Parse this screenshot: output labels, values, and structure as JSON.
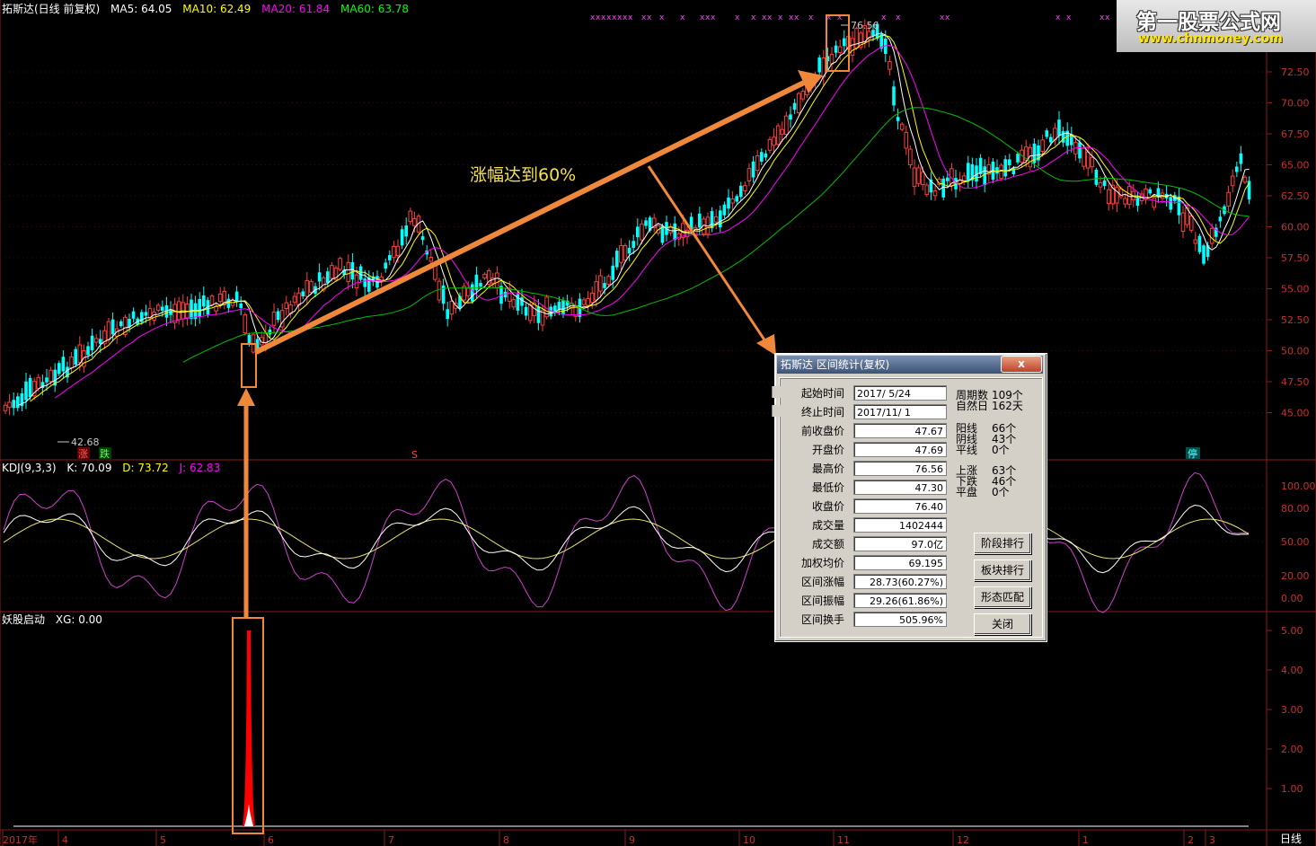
{
  "header": {
    "stock": "拓斯达(日线 前复权)",
    "ma5": "MA5: 64.05",
    "ma10": "MA10: 62.49",
    "ma20": "MA20: 61.84",
    "ma60": "MA60: 63.78"
  },
  "kdj_header": {
    "name": "KDJ(9,3,3)",
    "k": "K: 70.09",
    "d": "D: 73.72",
    "j": "J: 62.83"
  },
  "yao_header": {
    "name": "妖股启动",
    "xg": "XG: 0.00"
  },
  "logo": {
    "line1": "第一股票公式网",
    "line2": "www.chnmoney.com"
  },
  "annotation": {
    "text": "涨幅达到60%",
    "high": "76.56",
    "low": "42.68"
  },
  "markers": {
    "zhang": "涨",
    "die": "跌",
    "s": "S",
    "ting": "停"
  },
  "price_axis": [
    "72.50",
    "70.00",
    "67.50",
    "65.00",
    "62.50",
    "60.00",
    "57.50",
    "55.00",
    "52.50",
    "50.00",
    "47.50",
    "45.00"
  ],
  "kdj_axis": [
    "100.00",
    "80.00",
    "50.00",
    "20.00",
    "0.00"
  ],
  "yao_axis": [
    "5.00",
    "4.00",
    "3.00",
    "2.00",
    "1.00"
  ],
  "time_axis": [
    "2017年",
    "4",
    "5",
    "6",
    "7",
    "8",
    "9",
    "10",
    "11",
    "12",
    "1",
    "2",
    "3"
  ],
  "period": "日线",
  "colors": {
    "up": "#ff3c3c",
    "down": "#00ffff",
    "ma5": "#ffffff",
    "ma10": "#ffff00",
    "ma20": "#ff00ff",
    "ma60": "#00c000",
    "arrow": "#f0883c"
  },
  "dialog": {
    "title": "拓斯达 区间统计(复权)",
    "close_x": "x",
    "fields": [
      {
        "label": "起始时间",
        "value": "2017/ 5/24"
      },
      {
        "label": "终止时间",
        "value": "2017/11/ 1"
      },
      {
        "label": "前收盘价",
        "value": "47.67"
      },
      {
        "label": "开盘价",
        "value": "47.69"
      },
      {
        "label": "最高价",
        "value": "76.56"
      },
      {
        "label": "最低价",
        "value": "47.30"
      },
      {
        "label": "收盘价",
        "value": "76.40"
      },
      {
        "label": "成交量",
        "value": "1402444"
      },
      {
        "label": "成交额",
        "value": "97.0亿"
      },
      {
        "label": "加权均价",
        "value": "69.195"
      },
      {
        "label": "区间涨幅",
        "value": "28.73(60.27%)"
      },
      {
        "label": "区间振幅",
        "value": "29.26(61.86%)"
      },
      {
        "label": "区间换手",
        "value": "505.96%"
      }
    ],
    "stats": [
      {
        "k": "周期数",
        "v": "109个"
      },
      {
        "k": "自然日",
        "v": "162天"
      },
      {
        "k": "阳线",
        "v": "66个"
      },
      {
        "k": "阴线",
        "v": "43个"
      },
      {
        "k": "平线",
        "v": "0个"
      },
      {
        "k": "上涨",
        "v": "63个"
      },
      {
        "k": "下跌",
        "v": "46个"
      },
      {
        "k": "平盘",
        "v": "0个"
      }
    ],
    "buttons": [
      "阶段排行",
      "板块排行",
      "形态匹配",
      "关闭"
    ]
  }
}
